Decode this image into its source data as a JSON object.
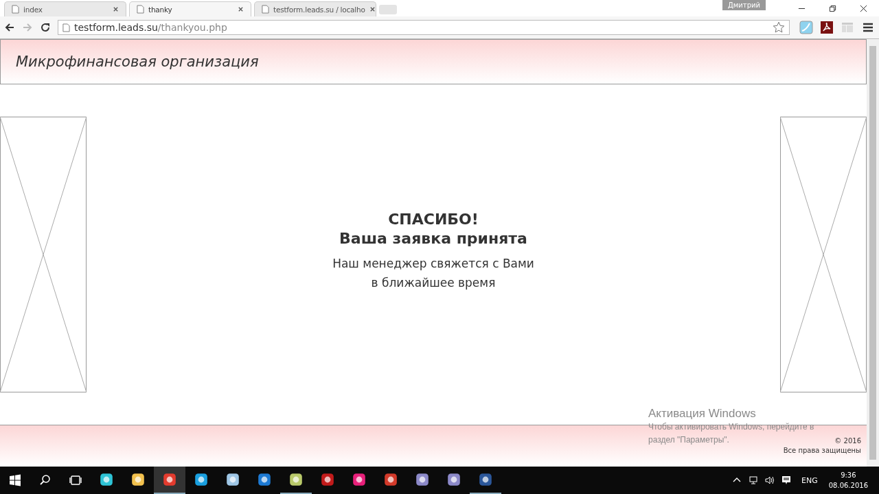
{
  "browser": {
    "tabs": [
      {
        "title": "index",
        "selected": false
      },
      {
        "title": "thanky",
        "selected": true
      },
      {
        "title": "testform.leads.su / localho",
        "selected": false
      }
    ],
    "profile": "Дмитрий",
    "address": {
      "host": "testform.leads.su",
      "path": "/thankyou.php"
    }
  },
  "page": {
    "header_title": "Микрофинансовая организация",
    "heading": [
      "СПАСИБО!",
      "Ваша заявка принята"
    ],
    "message": [
      "Наш менеджер свяжется с Вами",
      "в ближайшее время"
    ],
    "footer": {
      "copyright": "© 2016",
      "rights": "Все права защищены"
    }
  },
  "activation": {
    "title": "Активация Windows",
    "text": [
      "Чтобы активировать Windows, перейдите в",
      "раздел \"Параметры\"."
    ]
  },
  "taskbar": {
    "apps": [
      {
        "running": false,
        "selected": false
      },
      {
        "running": false,
        "selected": false
      },
      {
        "running": true,
        "selected": true
      },
      {
        "running": false,
        "selected": false
      },
      {
        "running": false,
        "selected": false
      },
      {
        "running": false,
        "selected": false
      },
      {
        "running": true,
        "selected": false
      },
      {
        "running": false,
        "selected": false
      },
      {
        "running": false,
        "selected": false
      },
      {
        "running": false,
        "selected": false
      },
      {
        "running": false,
        "selected": false
      },
      {
        "running": false,
        "selected": false
      },
      {
        "running": true,
        "selected": false
      }
    ],
    "language": "ENG",
    "time": "9:36",
    "date": "08.06.2016"
  }
}
